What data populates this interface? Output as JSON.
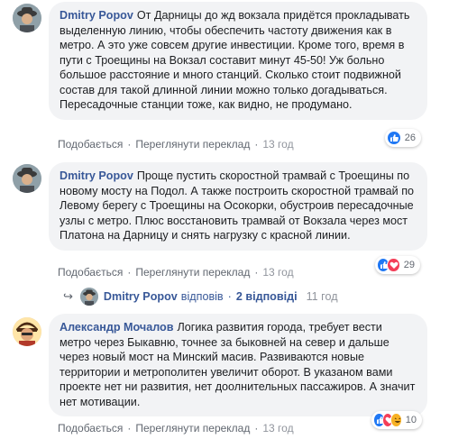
{
  "comments": [
    {
      "author": "Dmitry Popov",
      "text": "От Дарницы до жд вокзала придётся прокладывать выделенную линию, чтобы обеспечить частоту движения как в метро. А это уже совсем другие инвестиции. Кроме того, время в пути с Троещины на Вокзал составит минут 45-50! Уж больно большое расстояние и много станций. Сколько стоит подвижной состав для такой длинной линии можно только догадываться. Пересадочные станции тоже, как видно, не продумано.",
      "like_label": "Подобається",
      "translate_label": "Переглянути переклад",
      "time": "13 год",
      "reactions": [
        "like-icon"
      ],
      "reaction_count": "26"
    },
    {
      "author": "Dmitry Popov",
      "text": "Проще пустить скоростной трамвай с Троещины по новому мосту на Подол. А также построить скоростной трамвай по Левому берегу с Троещины на Осокорки, обустроив пересадочные узлы с метро. Плюс восстановить трамвай от Вокзала через мост Платона на Дарницу и снять нагрузку с красной линии.",
      "like_label": "Подобається",
      "translate_label": "Переглянути переклад",
      "time": "13 год",
      "reactions": [
        "like-icon",
        "love-icon"
      ],
      "reaction_count": "29"
    },
    {
      "author": "Александр Мочалов",
      "text": "Логика развития города, требует вести метро через Быкавню, точнее за быковней на север и дальше через новый мост на Минский масив. Развиваются новые территории и метрополитен увеличит оборот. В указаном вами проекте нет ни развития, нет доолнительных пассажиров. А значит нет мотивации.",
      "like_label": "Подобається",
      "translate_label": "Переглянути переклад",
      "time": "13 год",
      "reactions": [
        "like-icon",
        "love-icon",
        "haha-icon"
      ],
      "reaction_count": "10"
    }
  ],
  "replies": {
    "author": "Dmitry Popov",
    "verb": "відповів",
    "count_label": "2 відповіді",
    "time": "11 год"
  },
  "colors": {
    "bubble": "#f2f3f5",
    "link": "#385898",
    "like": "#2078f4",
    "love": "#f33e58",
    "haha": "#f7b125"
  }
}
